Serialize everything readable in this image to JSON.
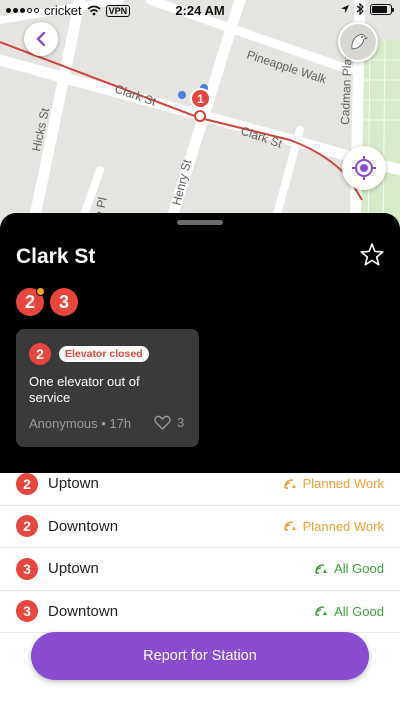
{
  "status_bar": {
    "carrier": "cricket",
    "vpn": "VPN",
    "time": "2:24 AM",
    "battery_level": 0.85
  },
  "map": {
    "streets": [
      "Pineapple Walk",
      "Clark St",
      "Clark St",
      "Hicks St",
      "Henry St",
      "Cadman Plaza W",
      "ge Pl"
    ],
    "marker_label": "1"
  },
  "station": {
    "name": "Clark St",
    "lines": [
      {
        "label": "2",
        "has_alert": true
      },
      {
        "label": "3",
        "has_alert": false
      }
    ]
  },
  "report": {
    "line": "2",
    "tag": "Elevator closed",
    "text": "One elevator out of service",
    "author": "Anonymous • 17h",
    "likes": "3"
  },
  "directions": [
    {
      "line": "2",
      "direction": "Uptown",
      "status": "Planned Work",
      "status_type": "planned"
    },
    {
      "line": "2",
      "direction": "Downtown",
      "status": "Planned Work",
      "status_type": "planned"
    },
    {
      "line": "3",
      "direction": "Uptown",
      "status": "All Good",
      "status_type": "good"
    },
    {
      "line": "3",
      "direction": "Downtown",
      "status": "All Good",
      "status_type": "good"
    }
  ],
  "actions": {
    "report_button": "Report for Station"
  },
  "colors": {
    "accent": "#8a4bd1",
    "line_red": "#e8453c",
    "planned": "#f0a030",
    "good": "#3ca33c"
  }
}
